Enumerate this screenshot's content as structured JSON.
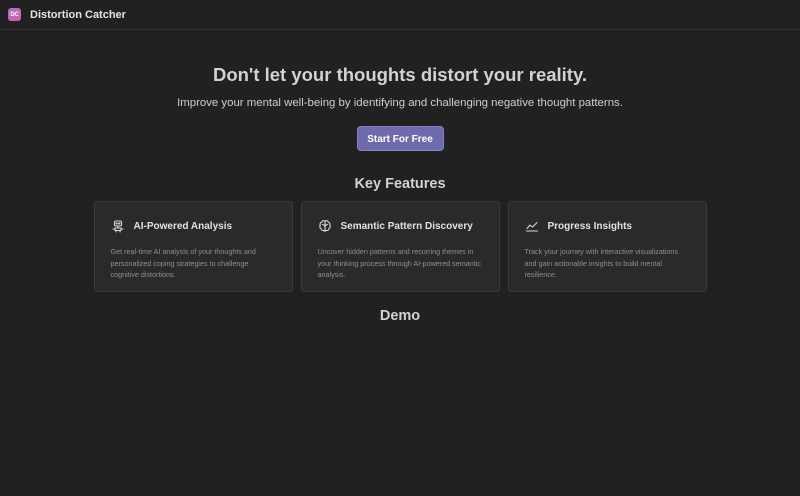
{
  "app": {
    "logo_text": "DC",
    "title": "Distortion Catcher"
  },
  "hero": {
    "heading": "Don't let your thoughts distort your reality.",
    "subheading": "Improve your mental well-being by identifying and challenging negative thought patterns.",
    "cta_label": "Start For Free"
  },
  "features": {
    "title": "Key Features",
    "items": [
      {
        "icon": "robot-icon",
        "title": "AI-Powered Analysis",
        "description": "Get real-time AI analysis of your thoughts and personalized coping strategies to challenge cognitive distortions."
      },
      {
        "icon": "brain-icon",
        "title": "Semantic Pattern Discovery",
        "description": "Uncover hidden patterns and recurring themes in your thinking process through AI-powered semantic analysis."
      },
      {
        "icon": "chart-line-icon",
        "title": "Progress Insights",
        "description": "Track your journey with interactive visualizations and gain actionable insights to build mental resilience."
      }
    ]
  },
  "demo": {
    "title": "Demo"
  },
  "colors": {
    "background": "#212121",
    "card": "#2a2a2a",
    "accent": "#6d6aae"
  }
}
